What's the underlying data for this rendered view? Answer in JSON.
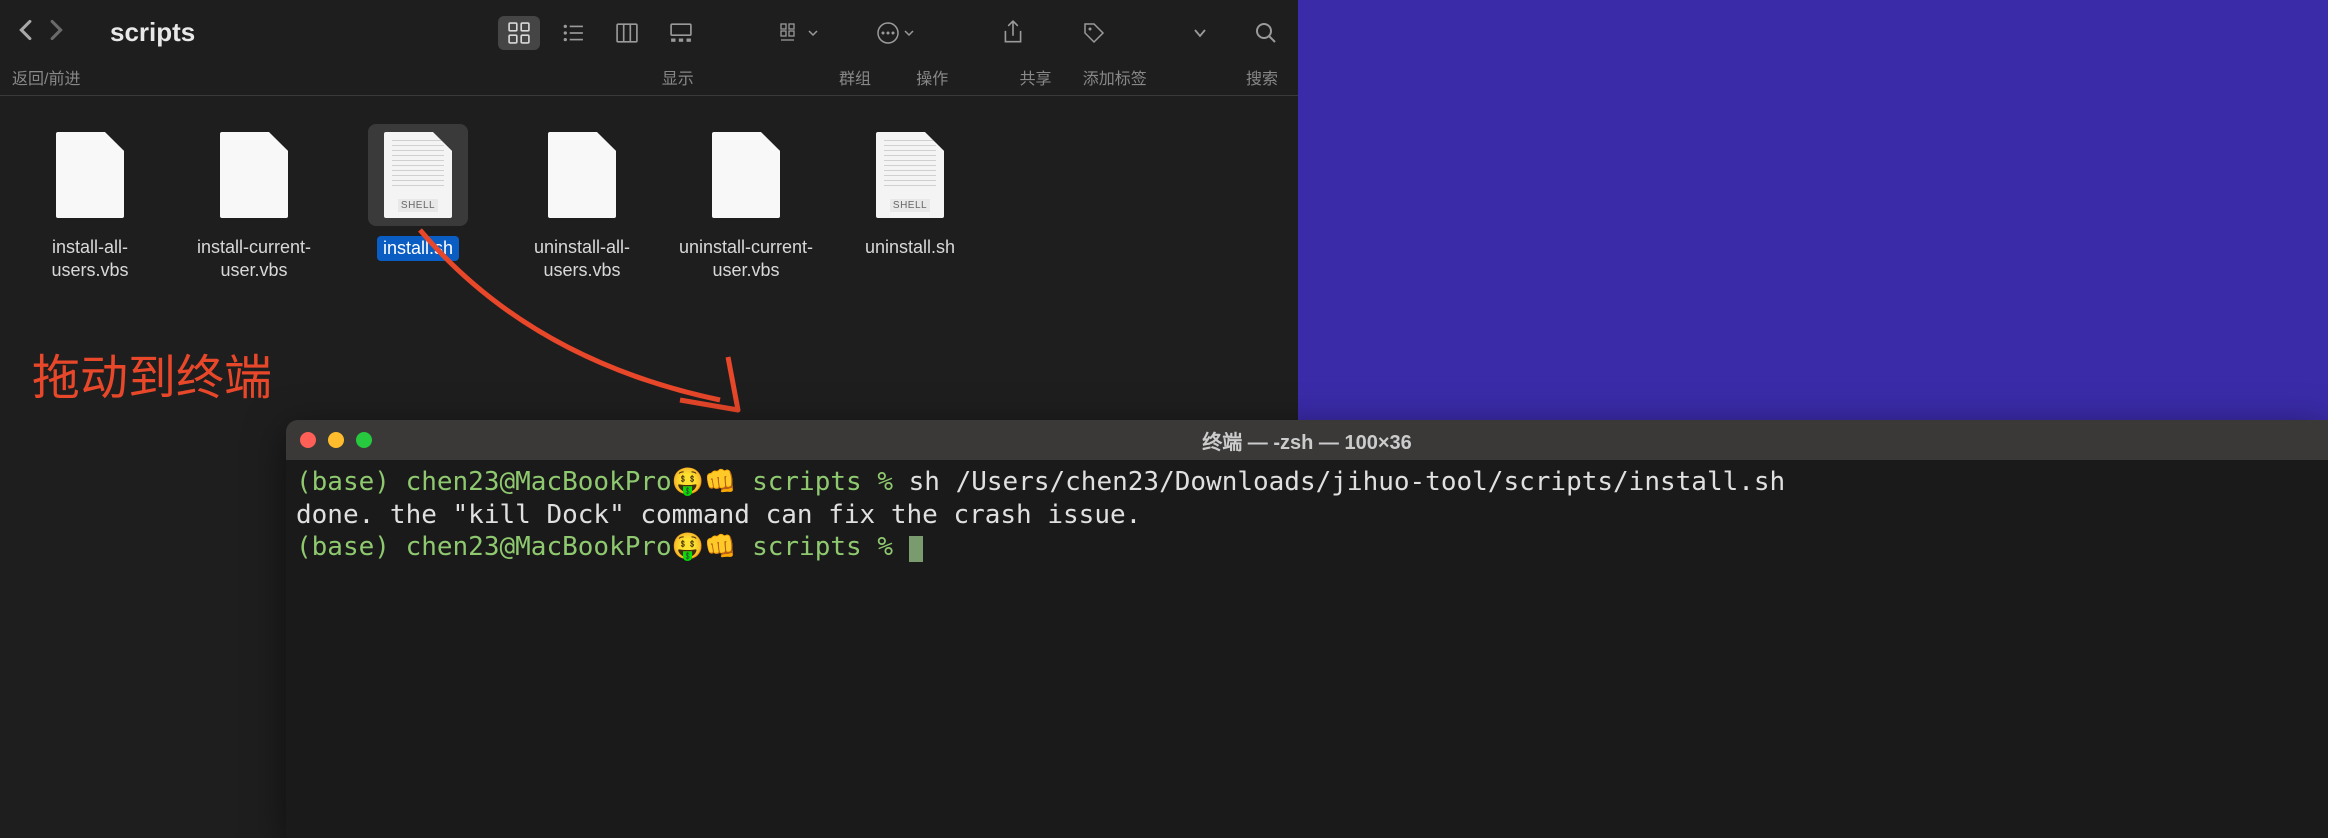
{
  "finder": {
    "title": "scripts",
    "back_forward_label": "返回/前进",
    "toolbar_labels": {
      "display": "显示",
      "group": "群组",
      "action": "操作",
      "share": "共享",
      "tags": "添加标签",
      "search": "搜索"
    },
    "files": [
      {
        "name": "install-all-users.vbs",
        "type": "vbs",
        "selected": false
      },
      {
        "name": "install-current-user.vbs",
        "type": "vbs",
        "selected": false
      },
      {
        "name": "install.sh",
        "type": "sh",
        "selected": true
      },
      {
        "name": "uninstall-all-users.vbs",
        "type": "vbs",
        "selected": false
      },
      {
        "name": "uninstall-current-user.vbs",
        "type": "vbs",
        "selected": false
      },
      {
        "name": "uninstall.sh",
        "type": "sh",
        "selected": false
      }
    ]
  },
  "annotation": {
    "text": "拖动到终端"
  },
  "terminal": {
    "title": "终端 — -zsh — 100×36",
    "prompt_prefix": "(base) chen23@MacBookPro🤑👊",
    "prompt_path": " scripts % ",
    "line1_cmd": "sh /Users/chen23/Downloads/jihuo-tool/scripts/install.sh",
    "line2": "done. the \"kill Dock\" command can fix the crash issue.",
    "shell_badge": "SHELL"
  }
}
